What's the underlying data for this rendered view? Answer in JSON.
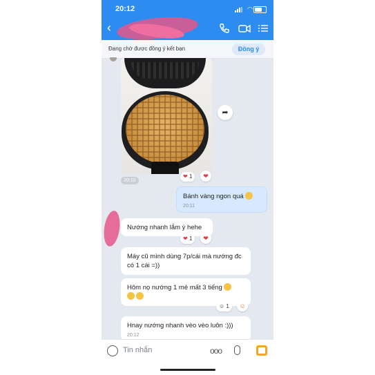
{
  "status_bar": {
    "time": "20:12"
  },
  "header": {
    "contact_name": ""
  },
  "banner": {
    "text": "Đang chờ được đồng ý kết bạn",
    "accept_label": "Đồng ý"
  },
  "messages": {
    "photo": {
      "time": "20:10",
      "reaction_count": "1"
    },
    "out1": {
      "text": "Bánh vàng ngon quá",
      "time": "20:11"
    },
    "in1": {
      "text": "Nướng nhanh lắm ý hehe",
      "reaction_count": "1"
    },
    "in2": {
      "text": "Máy cũ mình dùng 7p/cái mà nướng đc có 1 cái =))"
    },
    "in3": {
      "text": "Hôm nọ nướng 1 mẻ mất 3 tiếng",
      "reaction_count": "1"
    },
    "in4": {
      "text": "Hnay nướng nhanh vèo vèo luôn :)))",
      "time": "20:12"
    }
  },
  "composer": {
    "placeholder": "Tin nhắn",
    "more_label": "ooo"
  },
  "colors": {
    "header": "#2d8cf0",
    "chat_bg": "#e4e8ef",
    "outgoing_bubble": "#d6e9ff",
    "heart": "#e53945"
  }
}
